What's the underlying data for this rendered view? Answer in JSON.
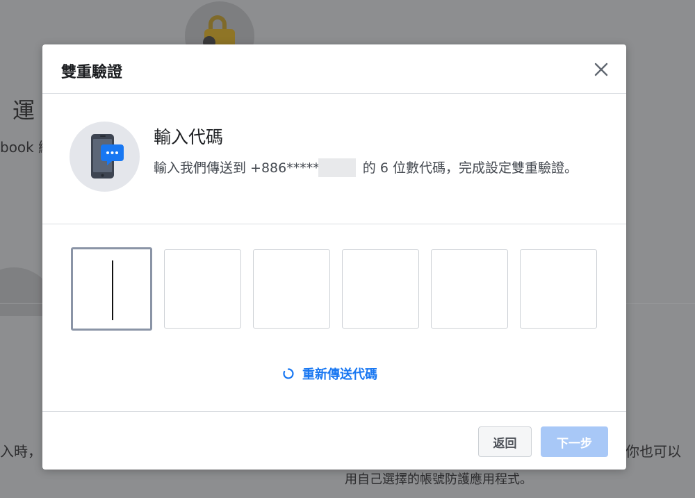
{
  "background": {
    "heading": "運",
    "subtext": "book 綁",
    "bottom_left_text": "入時，",
    "bottom_right_text": "你也可以",
    "bottom_center_text": "用自己選擇的帳號防護應用程式。"
  },
  "modal": {
    "title": "雙重驗證",
    "close_label": "×",
    "info": {
      "title": "輸入代碼",
      "desc_before": "輸入我們傳送到 +886*****",
      "desc_after": " 的 6 位數代碼，完成設定雙重驗證。"
    },
    "code_boxes": [
      "",
      "",
      "",
      "",
      "",
      ""
    ],
    "resend_label": "重新傳送代碼",
    "back_label": "返回",
    "next_label": "下一步"
  },
  "colors": {
    "accent": "#1877f2",
    "next_disabled": "#a8c8f7",
    "overlay": "#8d8e90"
  },
  "icons": {
    "close": "close-icon",
    "phone": "phone-message-icon",
    "resend": "refresh-icon",
    "lock": "lock-key-icon"
  }
}
